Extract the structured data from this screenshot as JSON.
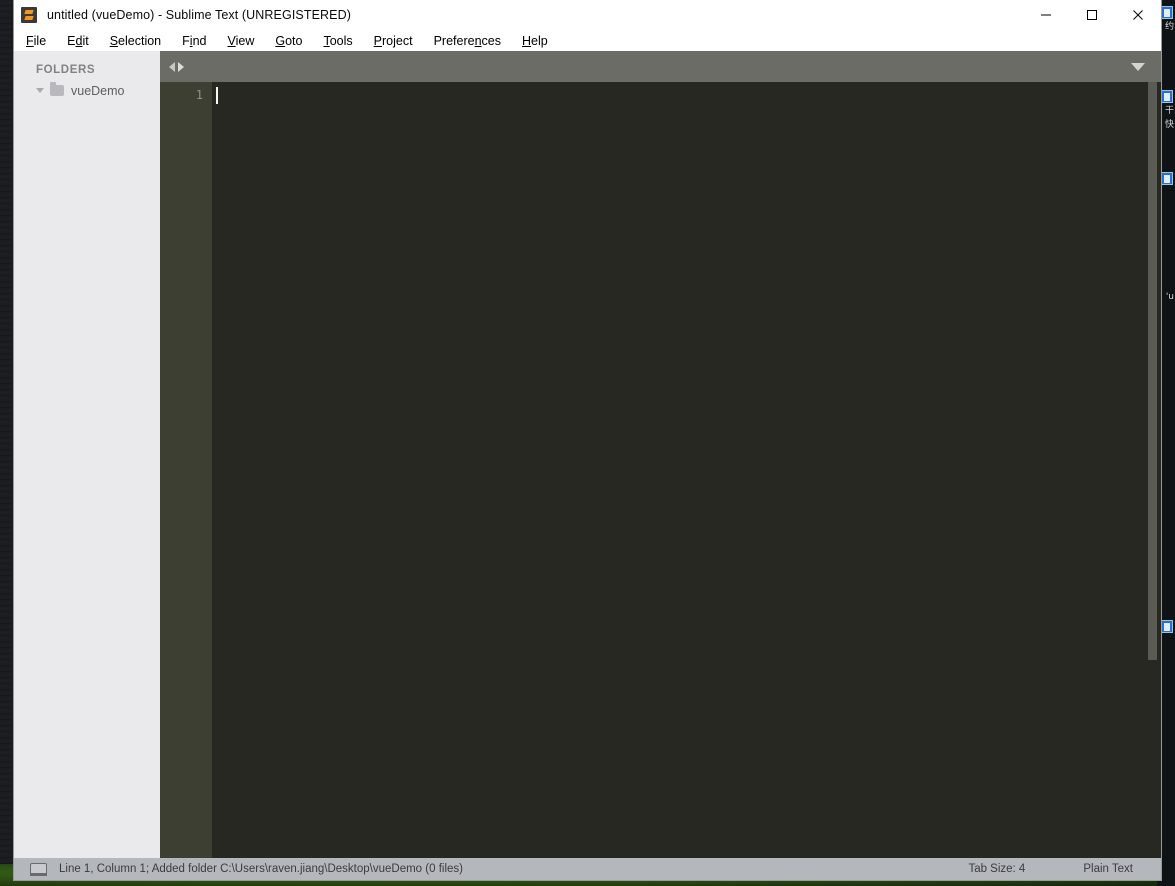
{
  "window": {
    "title": "untitled (vueDemo) - Sublime Text (UNREGISTERED)",
    "logo_icon": "sublime-text-logo-icon",
    "controls": {
      "minimize": "minimize-icon",
      "maximize": "maximize-icon",
      "close": "close-icon"
    }
  },
  "menubar": {
    "items": [
      {
        "label": "File",
        "accel_before": "",
        "accel": "F",
        "accel_after": "ile"
      },
      {
        "label": "Edit",
        "accel_before": "E",
        "accel": "d",
        "accel_after": "it"
      },
      {
        "label": "Selection",
        "accel_before": "",
        "accel": "S",
        "accel_after": "election"
      },
      {
        "label": "Find",
        "accel_before": "F",
        "accel": "i",
        "accel_after": "nd"
      },
      {
        "label": "View",
        "accel_before": "",
        "accel": "V",
        "accel_after": "iew"
      },
      {
        "label": "Goto",
        "accel_before": "",
        "accel": "G",
        "accel_after": "oto"
      },
      {
        "label": "Tools",
        "accel_before": "",
        "accel": "T",
        "accel_after": "ools"
      },
      {
        "label": "Project",
        "accel_before": "",
        "accel": "P",
        "accel_after": "roject"
      },
      {
        "label": "Preferences",
        "accel_before": "Prefere",
        "accel": "n",
        "accel_after": "ces"
      },
      {
        "label": "Help",
        "accel_before": "",
        "accel": "H",
        "accel_after": "elp"
      }
    ]
  },
  "sidebar": {
    "header": "FOLDERS",
    "folders": [
      {
        "name": "vueDemo",
        "expanded": true,
        "icon": "folder-icon",
        "disclosure_icon": "chevron-down-icon"
      }
    ]
  },
  "tabbar": {
    "nav_back_icon": "arrow-left-icon",
    "nav_forward_icon": "arrow-right-icon",
    "dropdown_icon": "chevron-down-icon",
    "tabs": []
  },
  "editor": {
    "line_numbers": [
      "1"
    ],
    "content": "",
    "caret_line": 1,
    "caret_column": 1,
    "background_color": "#272822",
    "gutter_color": "#3e3f33",
    "scrollbar_visible": true
  },
  "statusbar": {
    "icon": "monitor-icon",
    "message": "Line 1, Column 1; Added folder C:\\Users\\raven.jiang\\Desktop\\vueDemo (0 files)",
    "tab_size": "Tab Size: 4",
    "syntax": "Plain Text"
  },
  "desktop": {
    "icon_labels": [
      "约",
      "干",
      "快",
      "'u"
    ],
    "background_color": "#15171a"
  }
}
